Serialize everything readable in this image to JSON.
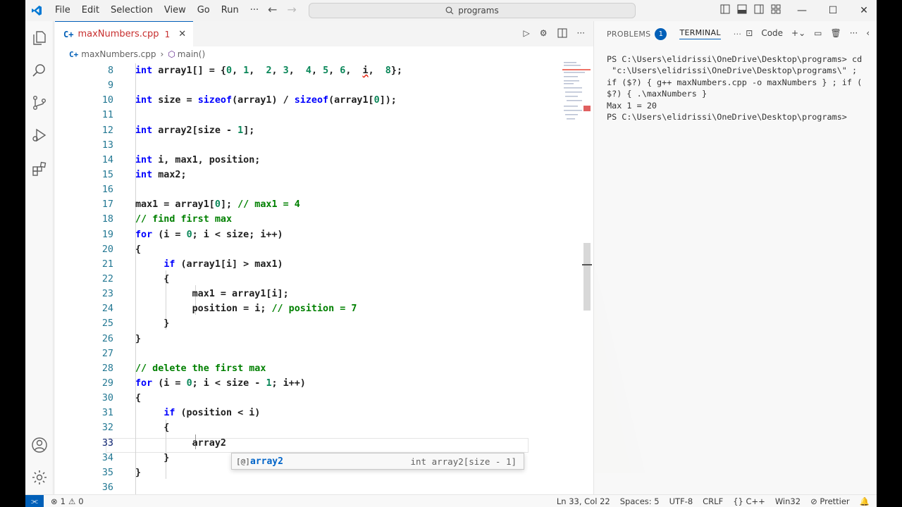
{
  "titlebar": {
    "menu": [
      "File",
      "Edit",
      "Selection",
      "View",
      "Go",
      "Run",
      "···"
    ],
    "search_text": "programs"
  },
  "editor": {
    "tab_name": "maxNumbers.cpp",
    "tab_badge": "1",
    "tab_icon": "C+",
    "breadcrumb": {
      "file": "maxNumbers.cpp",
      "symbol": "main()"
    },
    "lines": [
      {
        "n": "8",
        "html": "<span class='kw'>int</span> array1[] = {<span class='num'>0</span>, <span class='num'>1</span>,  <span class='num'>2</span>, <span class='num'>3</span>,  <span class='num'>4</span>, <span class='num'>5</span>, <span class='num'>6</span>,  <span class='squiggle'>i</span>,  <span class='num'>8</span>};"
      },
      {
        "n": "9",
        "html": ""
      },
      {
        "n": "10",
        "html": "<span class='kw'>int</span> size = <span class='kw'>sizeof</span>(array1) / <span class='kw'>sizeof</span>(array1[<span class='num'>0</span>]);"
      },
      {
        "n": "11",
        "html": ""
      },
      {
        "n": "12",
        "html": "<span class='kw'>int</span> array2[size - <span class='num'>1</span>];"
      },
      {
        "n": "13",
        "html": ""
      },
      {
        "n": "14",
        "html": "<span class='kw'>int</span> i, max1, position;"
      },
      {
        "n": "15",
        "html": "<span class='kw'>int</span> max2;"
      },
      {
        "n": "16",
        "html": ""
      },
      {
        "n": "17",
        "html": "max1 = array1[<span class='num'>0</span>]; <span class='cm'>// max1 = 4</span>"
      },
      {
        "n": "18",
        "html": "<span class='cm'>// find first max</span>"
      },
      {
        "n": "19",
        "html": "<span class='kw'>for</span> (i = <span class='num'>0</span>; i &lt; size; i++)"
      },
      {
        "n": "20",
        "html": "{"
      },
      {
        "n": "21",
        "html": "     <span class='kw'>if</span> (array1[i] &gt; max1)"
      },
      {
        "n": "22",
        "html": "     {"
      },
      {
        "n": "23",
        "html": "          max1 = array1[i];"
      },
      {
        "n": "24",
        "html": "          position = i; <span class='cm'>// position = 7</span>"
      },
      {
        "n": "25",
        "html": "     }"
      },
      {
        "n": "26",
        "html": "}"
      },
      {
        "n": "27",
        "html": ""
      },
      {
        "n": "28",
        "html": "<span class='cm'>// delete the first max</span>"
      },
      {
        "n": "29",
        "html": "<span class='kw'>for</span> (i = <span class='num'>0</span>; i &lt; size - <span class='num'>1</span>; i++)"
      },
      {
        "n": "30",
        "html": "{"
      },
      {
        "n": "31",
        "html": "     <span class='kw'>if</span> (position &lt; i)"
      },
      {
        "n": "32",
        "html": "     {"
      },
      {
        "n": "33",
        "html": "          array2"
      },
      {
        "n": "34",
        "html": "     }"
      },
      {
        "n": "35",
        "html": "}"
      },
      {
        "n": "36",
        "html": ""
      }
    ],
    "suggestion": {
      "icon": "[@]",
      "label": "array2",
      "detail": "int array2[size - 1]"
    }
  },
  "panel": {
    "problems_label": "PROBLEMS",
    "problems_count": "1",
    "terminal_label": "TERMINAL",
    "terminal_name": "Code",
    "terminal_output": "PS C:\\Users\\elidrissi\\OneDrive\\Desktop\\programs> cd\n \"c:\\Users\\elidrissi\\OneDrive\\Desktop\\programs\\\" ;\nif ($?) { g++ maxNumbers.cpp -o maxNumbers } ; if (\n$?) { .\\maxNumbers }\nMax 1 = 20\nPS C:\\Users\\elidrissi\\OneDrive\\Desktop\\programs>"
  },
  "statusbar": {
    "problems": "1",
    "warnings": "0",
    "position": "Ln 33, Col 22",
    "spaces": "Spaces: 5",
    "encoding": "UTF-8",
    "eol": "CRLF",
    "language": "C++",
    "platform": "Win32",
    "formatter": "Prettier"
  },
  "colors": {
    "accent": "#005fb8",
    "error": "#e51400",
    "keyword": "#0000ff",
    "number": "#098658",
    "comment": "#008000"
  }
}
